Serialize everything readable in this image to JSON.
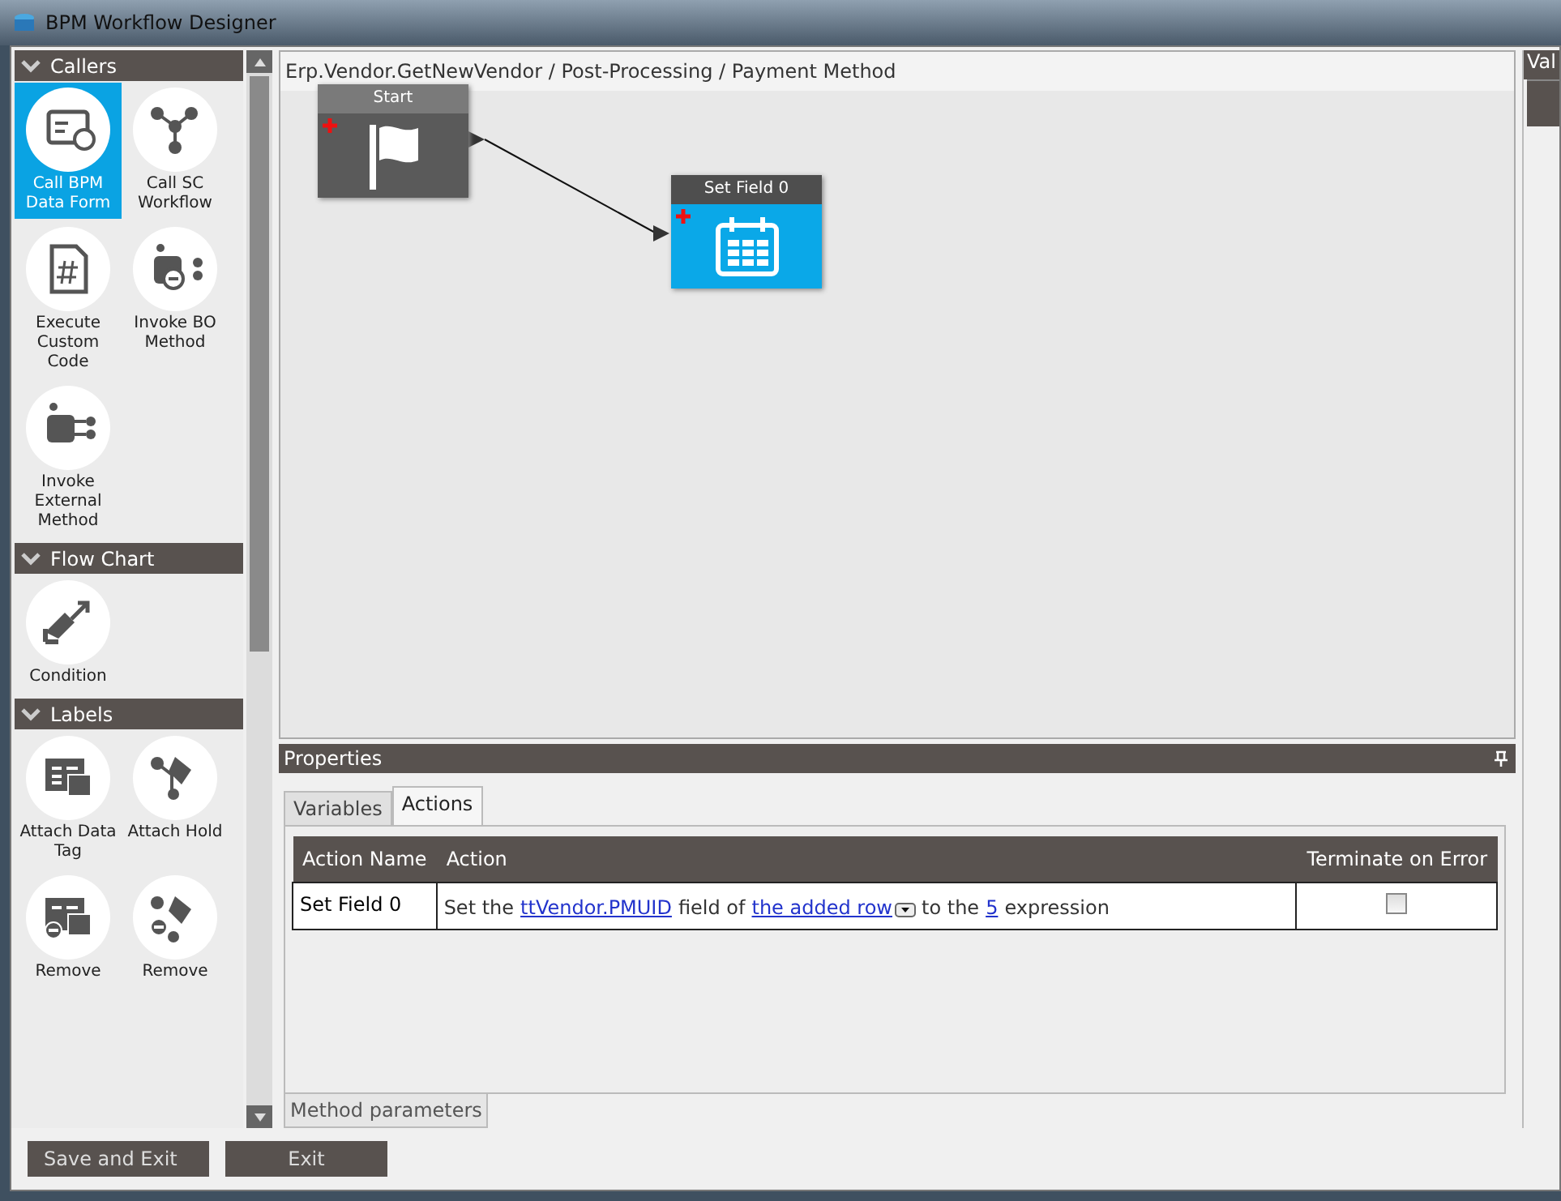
{
  "window": {
    "title": "BPM Workflow Designer"
  },
  "toolbox": [
    {
      "title": "Callers",
      "expanded": true,
      "items": [
        {
          "label": "Call BPM Data Form",
          "selected": true
        },
        {
          "label": "Call SC Workflow",
          "selected": false
        },
        {
          "label": "Execute Custom Code",
          "selected": false
        },
        {
          "label": "Invoke BO Method",
          "selected": false
        },
        {
          "label": "Invoke External Method",
          "selected": false
        }
      ]
    },
    {
      "title": "Flow Chart",
      "expanded": true,
      "items": [
        {
          "label": "Condition",
          "selected": false
        }
      ]
    },
    {
      "title": "Labels",
      "expanded": true,
      "items": [
        {
          "label": "Attach Data Tag",
          "selected": false
        },
        {
          "label": "Attach Hold",
          "selected": false
        },
        {
          "label": "Remove",
          "selected": false
        },
        {
          "label": "Remove",
          "selected": false
        }
      ]
    }
  ],
  "breadcrumb": "Erp.Vendor.GetNewVendor / Post-Processing / Payment Method",
  "nodes": [
    {
      "title": "Start",
      "selected": false
    },
    {
      "title": "Set Field 0",
      "selected": true
    }
  ],
  "properties": {
    "title": "Properties",
    "tabs": [
      {
        "label": "Variables",
        "selected": false
      },
      {
        "label": "Actions",
        "selected": true
      }
    ],
    "columns": [
      "Action Name",
      "Action",
      "Terminate on Error"
    ],
    "rows": [
      {
        "name": "Set Field 0",
        "action": [
          {
            "kind": "text",
            "text": "Set the"
          },
          {
            "kind": "link",
            "text": "ttVendor.PMUID"
          },
          {
            "kind": "text",
            "text": "field of"
          },
          {
            "kind": "dropdown",
            "text": "the added row"
          },
          {
            "kind": "text",
            "text": "to the"
          },
          {
            "kind": "link",
            "text": "5"
          },
          {
            "kind": "text",
            "text": "expression"
          }
        ],
        "terminate_on_error": false
      }
    ],
    "bottom_tab": "Method parameters"
  },
  "right_panel": {
    "header": "Val"
  },
  "buttons": [
    "Save and Exit",
    "Exit"
  ]
}
